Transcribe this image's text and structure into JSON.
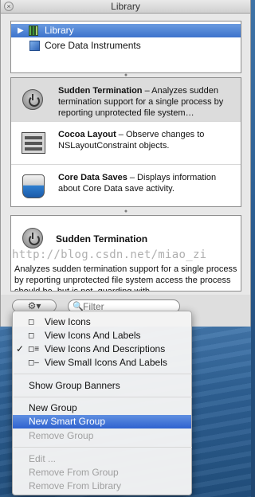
{
  "window": {
    "title": "Library",
    "close_glyph": "×"
  },
  "tree": {
    "root": {
      "label": "Library",
      "icon": "books-icon"
    },
    "child": {
      "label": "Core Data Instruments",
      "icon": "cube-icon"
    }
  },
  "instruments": [
    {
      "name": "Sudden Termination",
      "desc": " – Analyzes sudden termination support for a single process by reporting unprotected file system…",
      "icon": "gauge-icon"
    },
    {
      "name": "Cocoa Layout",
      "desc": " – Observe changes to NSLayoutConstraint objects.",
      "icon": "layout-icon"
    },
    {
      "name": "Core Data Saves",
      "desc": " – Displays information about Core Data save activity.",
      "icon": "core-data-icon"
    }
  ],
  "detail": {
    "name": "Sudden Termination",
    "desc": "Analyzes sudden termination support for a single process by reporting unprotected file system access the process should be, but is not, guarding with"
  },
  "watermark": "http://blog.csdn.net/miao_zi",
  "toolbar": {
    "action_label": "⚙▾",
    "search_placeholder": "Filter",
    "search_glyph": "🔍"
  },
  "menu": {
    "check": "✓",
    "view_options": [
      {
        "label": "View Icons",
        "glyph": "◻",
        "checked": false
      },
      {
        "label": "View Icons And Labels",
        "glyph": "◻",
        "checked": false
      },
      {
        "label": "View Icons And Descriptions",
        "glyph": "◻≡",
        "checked": true
      },
      {
        "label": "View Small Icons And Labels",
        "glyph": "◻–",
        "checked": false
      }
    ],
    "show_group_banners": "Show Group Banners",
    "new_group": "New Group",
    "new_smart_group": "New Smart Group",
    "remove_group": "Remove Group",
    "edit": "Edit ...",
    "remove_from_group": "Remove From Group",
    "remove_from_library": "Remove From Library"
  }
}
